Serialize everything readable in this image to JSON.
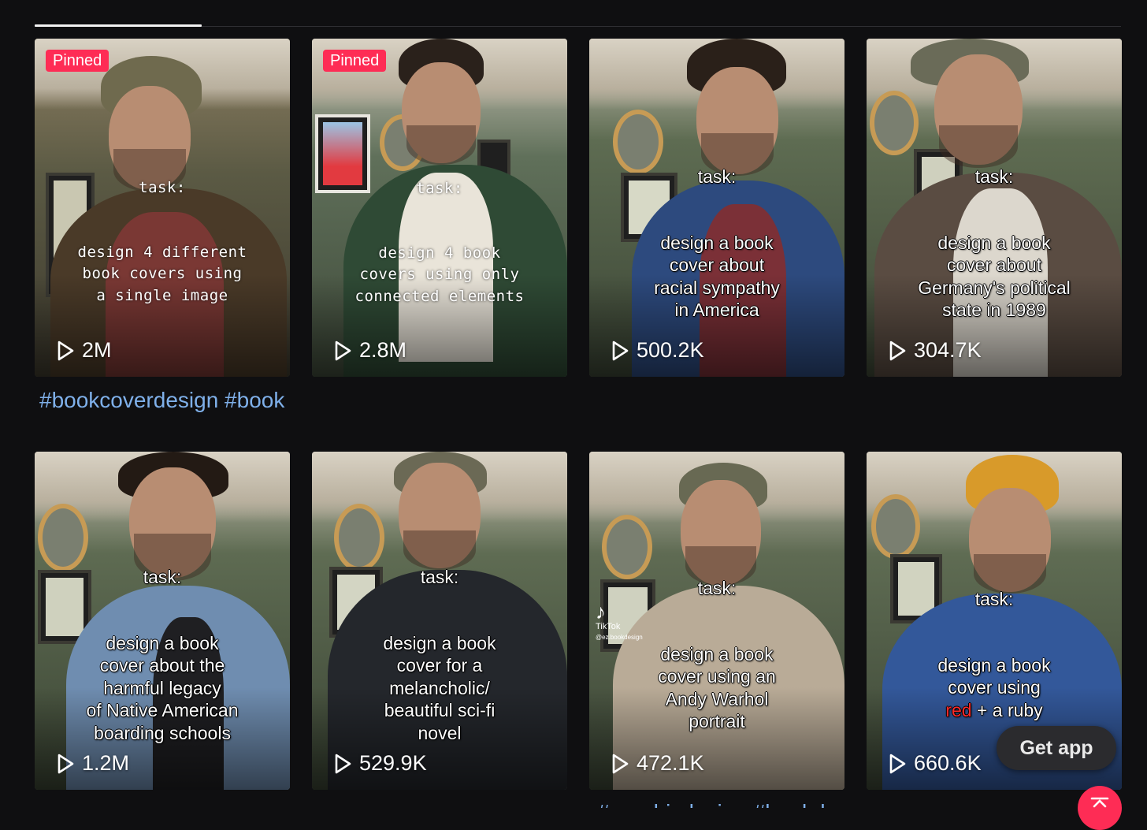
{
  "tabs": {
    "active_index": 0
  },
  "videos": [
    {
      "pinned": "Pinned",
      "caption_style": "mono",
      "task": "task:",
      "caption": "design 4 different\nbook covers using\na single image",
      "views": "2M"
    },
    {
      "pinned": "Pinned",
      "caption_style": "mono",
      "task": "task:",
      "caption": "design 4 book\ncovers using only\nconnected elements",
      "views": "2.8M"
    },
    {
      "pinned": "",
      "caption_style": "sans",
      "task": "task:",
      "caption": "design a book\ncover about\nracial sympathy\nin America",
      "views": "500.2K"
    },
    {
      "pinned": "",
      "caption_style": "sans",
      "task": "task:",
      "caption": "design a book\ncover about\nGermany's political\nstate in 1989",
      "views": "304.7K"
    },
    {
      "pinned": "",
      "caption_style": "sans",
      "task": "task:",
      "caption": "design a book\ncover about the\nharmful legacy\nof Native American\nboarding schools",
      "views": "1.2M"
    },
    {
      "pinned": "",
      "caption_style": "sans",
      "task": "task:",
      "caption": "design a book\ncover for a\nmelancholic/\nbeautiful sci-fi\nnovel",
      "views": "529.9K"
    },
    {
      "pinned": "",
      "caption_style": "sans",
      "task": "task:",
      "caption": "design a book\ncover using an\nAndy Warhol\nportrait",
      "views": "472.1K",
      "watermark": "TikTok",
      "watermark_user": "@ez.bookdesign"
    },
    {
      "pinned": "",
      "caption_style": "sans",
      "task": "task:",
      "caption_pre": "design a book\ncover using\n",
      "caption_red": "red",
      "caption_post": " + a ruby",
      "views": "660.6K"
    }
  ],
  "description_row1": "#bookcoverdesign #bookcoverdesign",
  "description_row2": "#graphicdesign #bookdesign",
  "get_app": "Get app",
  "colors": {
    "accent": "#fe2c55",
    "hashtag": "#7fb0ea",
    "background": "#0f0f11"
  }
}
